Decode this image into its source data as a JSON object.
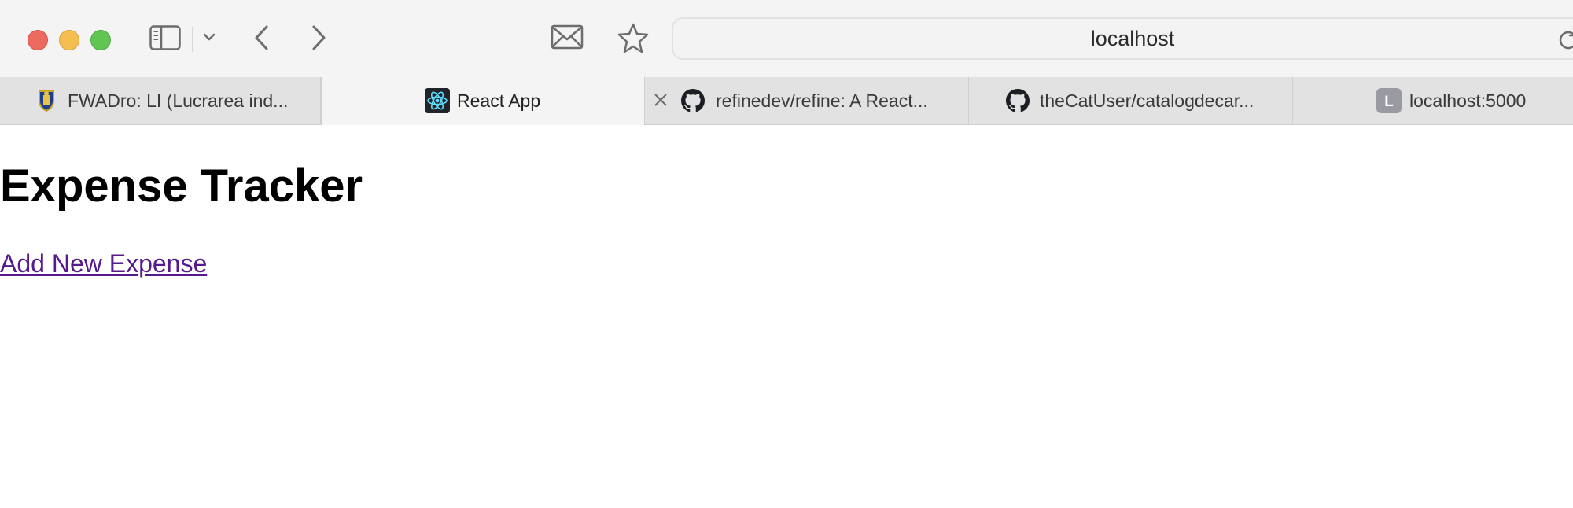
{
  "browser": {
    "address": "localhost",
    "colors": {
      "close": "#ed6a5e",
      "minimize": "#f4bf4f",
      "zoom": "#61c554",
      "visited_link": "#551a8b"
    },
    "toolbar_icons": [
      "sidebar-icon",
      "chevron-down-icon",
      "back-icon",
      "forward-icon",
      "mail-icon",
      "star-icon",
      "reload-icon"
    ],
    "tabs": [
      {
        "label": "FWADro: LI (Lucrarea ind...",
        "icon": "university-crest-icon"
      },
      {
        "label": "React App",
        "icon": "react-logo-icon",
        "active": true
      },
      {
        "label": "refinedev/refine: A React...",
        "icon": "github-icon"
      },
      {
        "label": "theCatUser/catalogdecar...",
        "icon": "github-icon"
      },
      {
        "label": "localhost:5000",
        "icon": "letter-l-icon",
        "icon_letter": "L"
      }
    ]
  },
  "page": {
    "title": "Expense Tracker",
    "add_link": "Add New Expense"
  }
}
